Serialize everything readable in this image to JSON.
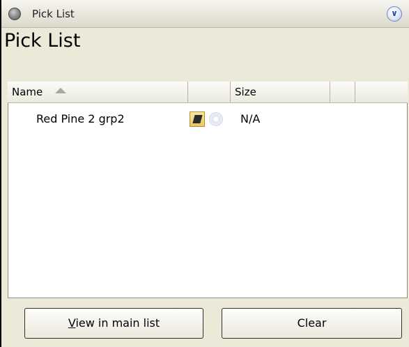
{
  "window": {
    "title": "Pick List"
  },
  "heading": "Pick List",
  "columns": [
    {
      "label": "Name",
      "sorted": "ascending"
    },
    {
      "label": ""
    },
    {
      "label": "Size"
    },
    {
      "label": ""
    },
    {
      "label": ""
    }
  ],
  "rows": [
    {
      "name": "Red Pine 2 grp2",
      "icons": [
        "book-icon",
        "disc-icon"
      ],
      "size": "N/A"
    }
  ],
  "buttons": {
    "view_mnemonic": "V",
    "view_rest": "iew in main list",
    "clear": "Clear"
  }
}
